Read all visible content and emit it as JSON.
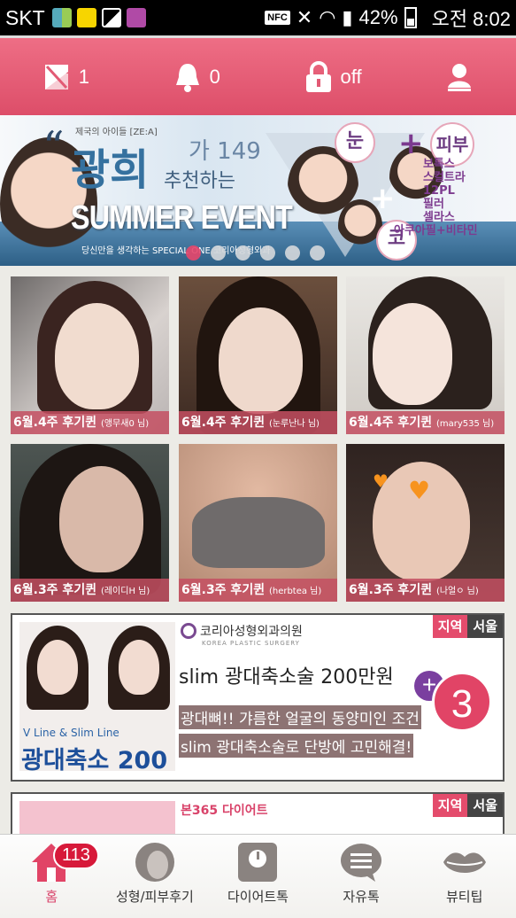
{
  "status_bar": {
    "carrier": "SKT",
    "battery": "42%",
    "time": "오전 8:02",
    "nfc": "NFC",
    "icons": [
      "talk-icon",
      "gallery-icon",
      "v-app-icon",
      "nfc-icon",
      "mute-icon",
      "wifi-icon",
      "signal-icon",
      "battery-icon"
    ]
  },
  "header": {
    "coupon_count": "1",
    "alarm_count": "0",
    "lock_state": "off"
  },
  "banner": {
    "small_text": "제국의 아이들 [ZE:A]",
    "headline": "광희",
    "number": "가 149",
    "recommend": "추천하는",
    "event": "SUMMER EVENT",
    "tagline": "당신만을 생각하는 SPECIAL ONE 코리아성형외과",
    "eye": "눈",
    "skin": "피부",
    "nose": "코",
    "skin_list": [
      "보톡스",
      "스컬트라",
      "12PL",
      "필러",
      "셀라스",
      "아쿠아필+비타민"
    ],
    "slides": 6,
    "active_slide": 0
  },
  "reviews": [
    {
      "week": "6월.4주 후기퀸",
      "user": "(앵무새0 님)"
    },
    {
      "week": "6월.4주 후기퀸",
      "user": "(눈루난나 님)"
    },
    {
      "week": "6월.4주 후기퀸",
      "user": "(mary535 님)"
    },
    {
      "week": "6월.3주 후기퀸",
      "user": "(레이디H 님)"
    },
    {
      "week": "6월.3주 후기퀸",
      "user": "(herbtea 님)"
    },
    {
      "week": "6월.3주 후기퀸",
      "user": "(나얼ㅇ 님)"
    }
  ],
  "ads": [
    {
      "clinic": "코리아성형외과의원",
      "clinic_sub": "KOREA PLASTIC SURGERY",
      "region_label": "지역",
      "region": "서울",
      "title": "slim 광대축소술 200만원",
      "desc1": "광대뼈!! 갸름한 얼굴의 동양미인 조건",
      "desc2": "slim 광대축소술로 단방에 고민해결!",
      "pic_line": "V Line & Slim Line",
      "pic_big": "광대축소 200",
      "fab_count": "3"
    },
    {
      "clinic": "본365 다이어트",
      "region_label": "지역",
      "region": "서울"
    }
  ],
  "tabs": [
    {
      "label": "홈",
      "badge": "113",
      "icon": "home-icon"
    },
    {
      "label": "성형/피부후기",
      "icon": "face-icon"
    },
    {
      "label": "다이어트톡",
      "icon": "scale-icon"
    },
    {
      "label": "자유톡",
      "icon": "chat-icon"
    },
    {
      "label": "뷰티팁",
      "icon": "lips-icon"
    }
  ],
  "colors": {
    "accent": "#e44c6c",
    "header": "#e25a74"
  }
}
